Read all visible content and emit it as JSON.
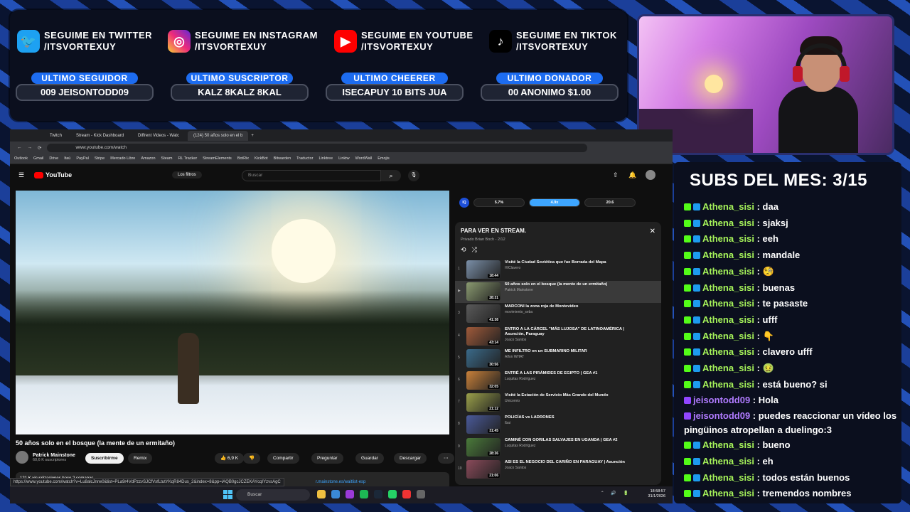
{
  "social": [
    {
      "icon": "twitter-icon",
      "line1": "SEGUIME EN TWITTER",
      "line2": "/ITSVORTEXUY",
      "color": "#1da1f2"
    },
    {
      "icon": "instagram-icon",
      "line1": "SEGUIME EN INSTAGRAM",
      "line2": "/ITSVORTEXUY",
      "color": "#d6249f"
    },
    {
      "icon": "youtube-icon",
      "line1": "SEGUIME EN YOUTUBE",
      "line2": "/ITSVORTEXUY",
      "color": "#ff0000"
    },
    {
      "icon": "tiktok-icon",
      "line1": "SEGUIME EN TIKTOK",
      "line2": "/ITSVORTEXUY",
      "color": "#000000"
    }
  ],
  "stats": [
    {
      "label": "ULTIMO SEGUIDOR",
      "value": "009        JEISONTODD09"
    },
    {
      "label": "ULTIMO SUSCRIPTOR",
      "value": "KALZ        8KALZ        8KAL"
    },
    {
      "label": "ULTIMO CHEERER",
      "value": "ISECAPUY 10 BITS        JUA"
    },
    {
      "label": "ULTIMO DONADOR",
      "value": "00        ANONIMO $1.00"
    }
  ],
  "chat": {
    "title": "SUBS DEL MES: 3/15",
    "messages": [
      {
        "name": "Athena_sisi",
        "text": "daa",
        "platform": "kick"
      },
      {
        "name": "Athena_sisi",
        "text": "sjaksj",
        "platform": "kick"
      },
      {
        "name": "Athena_sisi",
        "text": "eeh",
        "platform": "kick"
      },
      {
        "name": "Athena_sisi",
        "text": "mandale",
        "platform": "kick"
      },
      {
        "name": "Athena_sisi",
        "text": "🧐",
        "platform": "kick"
      },
      {
        "name": "Athena_sisi",
        "text": "buenas",
        "platform": "kick"
      },
      {
        "name": "Athena_sisi",
        "text": "te pasaste",
        "platform": "kick"
      },
      {
        "name": "Athena_sisi",
        "text": "ufff",
        "platform": "kick"
      },
      {
        "name": "Athena_sisi",
        "text": "👇",
        "platform": "kick"
      },
      {
        "name": "Athena_sisi",
        "text": "clavero ufff",
        "platform": "kick"
      },
      {
        "name": "Athena_sisi",
        "text": "🤢",
        "platform": "kick"
      },
      {
        "name": "Athena_sisi",
        "text": "está bueno? si",
        "platform": "kick"
      },
      {
        "name": "jeisontodd09",
        "text": "Hola",
        "platform": "twitch"
      },
      {
        "name": "jeisontodd09",
        "text": "puedes reaccionar un vídeo los pingüinos atropellan a duelingo:3",
        "platform": "twitch"
      },
      {
        "name": "Athena_sisi",
        "text": "bueno",
        "platform": "kick"
      },
      {
        "name": "Athena_sisi",
        "text": "eh",
        "platform": "kick"
      },
      {
        "name": "Athena_sisi",
        "text": "todos están buenos",
        "platform": "kick"
      },
      {
        "name": "Athena_sisi",
        "text": "tremendos nombres",
        "platform": "kick"
      }
    ]
  },
  "browser": {
    "tabs": [
      "Twitch",
      "Stream - Kick Dashboard",
      "Diffrent Videos - Watc",
      "(124) 50 años solo en el b"
    ],
    "url": "www.youtube.com/watch",
    "bookmarks": [
      "Outlook",
      "Gmail",
      "Drive",
      "Itaú",
      "PayPal",
      "Stripe",
      "Mercado Libre",
      "Amazon",
      "Steam",
      "RL Tracker",
      "StreamElements",
      "BotRix",
      "KickBot",
      "Bitwarden",
      "Traductor",
      "Linktree",
      "Linktw",
      "WordWall",
      "Emojis"
    ]
  },
  "youtube": {
    "logo": "YouTube",
    "filters": "Los filtros",
    "search_placeholder": "Buscar",
    "video_title": "50 años solo en el bosque (la mente de un ermitaño)",
    "channel": "Patrick Mainstone",
    "subs": "60,6 K suscriptores",
    "subscribe": "Suscribirme",
    "remix": "Remix",
    "likes": "6,9 K",
    "share": "Compartir",
    "ask": "Preguntar",
    "save": "Guardar",
    "download": "Descargar",
    "desc": "121 K visualizaciones  hace 2 semanas",
    "hover_url": "https://www.youtube.com/watch?v=Lu8alcJnrw0&list=PLa9r4VdPzzvSJCfVxfLtutYKqR84Dus_2&index=8&pp=iAQB0gcJCZEKAYcqIYzvsAgC",
    "link": "r.mainstone.es/waitlist-esp"
  },
  "speed": {
    "a": "5.7%",
    "b": "4.9x",
    "c": "20.6"
  },
  "playlist": {
    "title": "PARA VER EN STREAM.",
    "sub": "Privado  Brian Boch - 2/12",
    "items": [
      {
        "n": "1",
        "title": "Visité la Ciudad Soviética que fue Borrada del Mapa",
        "channel": "HIClavero",
        "dur": "18:44",
        "color": "#7a8fa8"
      },
      {
        "n": "▶",
        "title": "50 años solo en el bosque (la mente de un ermitaño)",
        "channel": "Patrick Mainstone",
        "dur": "28:31",
        "color": "#8a9a70"
      },
      {
        "n": "3",
        "title": "MARCONI la zona roja de Montevideo",
        "channel": "movimiento_seba",
        "dur": "41:38",
        "color": "#5a5a5a"
      },
      {
        "n": "4",
        "title": "ENTRO A LA CÁRCEL \"MÁS LUJOSA\" DE LATINOAMÉRICA | Asunción, Paraguay",
        "channel": "Joaco Santos",
        "dur": "43:14",
        "color": "#a05a3a"
      },
      {
        "n": "5",
        "title": "ME INFILTRO en un SUBMARINO MILITAR",
        "channel": "Alfon WHAT",
        "dur": "30:56",
        "color": "#3a6a8a"
      },
      {
        "n": "6",
        "title": "ENTRÉ A LAS PIRÁMIDES DE EGIPTO | GEA #1",
        "channel": "Luquitas Rodríguez",
        "dur": "32:05",
        "color": "#c8803a"
      },
      {
        "n": "7",
        "title": "Visité la Estación de Servicio Más Grande del Mundo",
        "channel": "Unicornio",
        "dur": "21:12",
        "color": "#9aa04a"
      },
      {
        "n": "8",
        "title": "POLICÍAS vs LADRONES",
        "channel": "Ibai",
        "dur": "31:45",
        "color": "#4a5a9a"
      },
      {
        "n": "9",
        "title": "CAMINÉ CON GORILAS SALVAJES EN UGANDA | GEA #2",
        "channel": "Luquitas Rodríguez",
        "dur": "28:36",
        "color": "#4a7a3a"
      },
      {
        "n": "10",
        "title": "ASI ES EL NEGOCIO DEL CARIÑO EN PARAGUAY | Asunción",
        "channel": "Joaco Santos",
        "dur": "21:06",
        "color": "#8a4a5a"
      }
    ]
  },
  "taskbar": {
    "search": "Buscar",
    "time": "18:58:57",
    "date": "31/1/2026"
  }
}
